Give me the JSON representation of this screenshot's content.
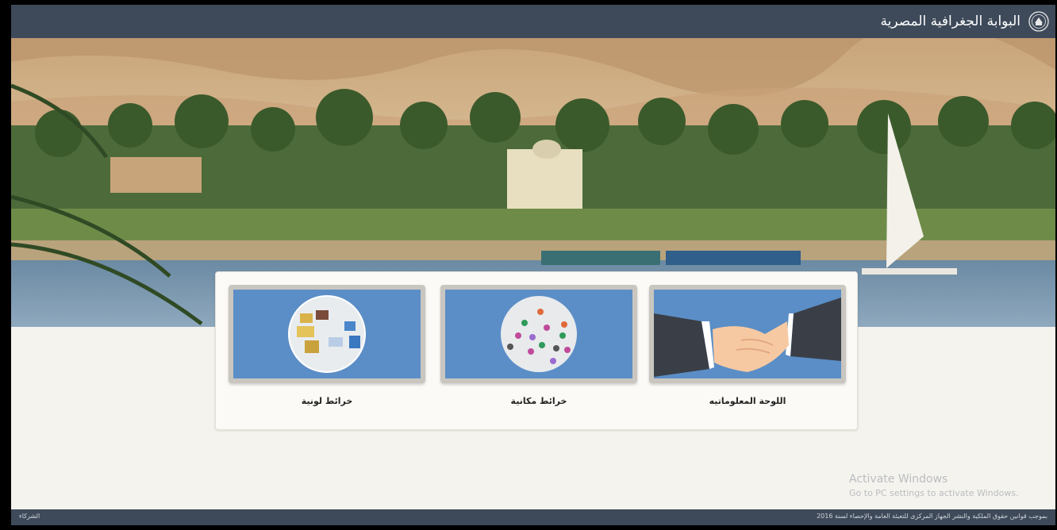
{
  "header": {
    "title": "البوابة الجغرافية المصرية",
    "logo_icon": "egypt-emblem-icon",
    "bar_color": "#3e4a5a"
  },
  "hero": {
    "scene": "nile-landscape-image"
  },
  "cards": [
    {
      "label": "اللوحة المعلوماتيه",
      "icon": "handshake-icon"
    },
    {
      "label": "خرائط مكانية",
      "icon": "map-pins-icon"
    },
    {
      "label": "خرائط لونية",
      "icon": "colored-map-icon"
    }
  ],
  "footer": {
    "copyright": "بموجب قوانين حقوق الملكية والنشر الجهاز المركزى للتعبئة العامة والإحصاء لسنة 2016",
    "partners": "الشركاء"
  },
  "os_watermark": {
    "line1": "Activate Windows",
    "line2": "Go to PC settings to activate Windows."
  },
  "colors": {
    "card_background": "#5b8ec6",
    "page_background": "#f5f3ee"
  }
}
